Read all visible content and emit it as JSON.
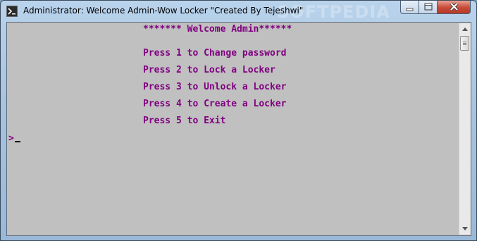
{
  "window": {
    "title": "Administrator:  Welcome Admin-Wow Locker \"Created By Tejeshwi\"",
    "watermark": "SOFTPEDIA"
  },
  "console": {
    "header": "******* Welcome Admin******",
    "menu": [
      "Press 1 to Change password",
      "Press 2 to Lock a Locker",
      "Press 3 to Unlock a Locker",
      "Press 4 to Create a Locker",
      "Press 5 to Exit"
    ],
    "prompt": ">",
    "text_color": "#800080",
    "background_color": "#c0c0c0"
  }
}
